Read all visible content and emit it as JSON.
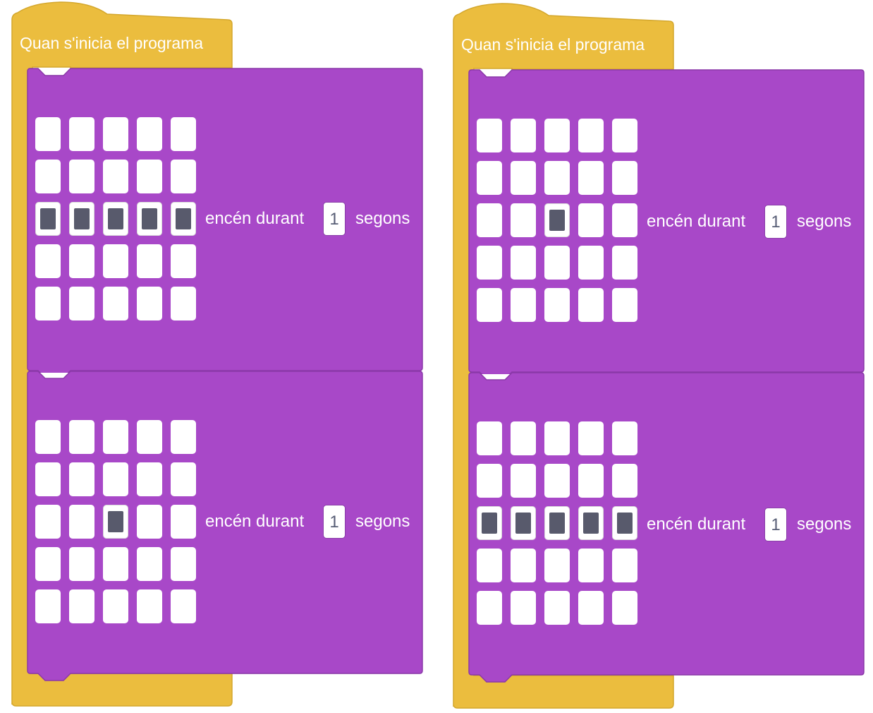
{
  "programs": [
    {
      "hat_label": "Quan s'inicia el programa",
      "blocks": [
        {
          "leds": [
            [
              0,
              0,
              0,
              0,
              0
            ],
            [
              0,
              0,
              0,
              0,
              0
            ],
            [
              1,
              1,
              1,
              1,
              1
            ],
            [
              0,
              0,
              0,
              0,
              0
            ],
            [
              0,
              0,
              0,
              0,
              0
            ]
          ],
          "label_before": "encén durant",
          "duration": "1",
          "label_after": "segons"
        },
        {
          "leds": [
            [
              0,
              0,
              0,
              0,
              0
            ],
            [
              0,
              0,
              0,
              0,
              0
            ],
            [
              0,
              0,
              1,
              0,
              0
            ],
            [
              0,
              0,
              0,
              0,
              0
            ],
            [
              0,
              0,
              0,
              0,
              0
            ]
          ],
          "label_before": "encén durant",
          "duration": "1",
          "label_after": "segons"
        }
      ]
    },
    {
      "hat_label": "Quan s'inicia el programa",
      "blocks": [
        {
          "leds": [
            [
              0,
              0,
              0,
              0,
              0
            ],
            [
              0,
              0,
              0,
              0,
              0
            ],
            [
              0,
              0,
              1,
              0,
              0
            ],
            [
              0,
              0,
              0,
              0,
              0
            ],
            [
              0,
              0,
              0,
              0,
              0
            ]
          ],
          "label_before": "encén durant",
          "duration": "1",
          "label_after": "segons"
        },
        {
          "leds": [
            [
              0,
              0,
              0,
              0,
              0
            ],
            [
              0,
              0,
              0,
              0,
              0
            ],
            [
              1,
              1,
              1,
              1,
              1
            ],
            [
              0,
              0,
              0,
              0,
              0
            ],
            [
              0,
              0,
              0,
              0,
              0
            ]
          ],
          "label_before": "encén durant",
          "duration": "1",
          "label_after": "segons"
        }
      ]
    }
  ],
  "colors": {
    "event_yellow": "#ebbd3e",
    "event_border": "#d4a72c",
    "looks_purple": "#a848c8",
    "looks_border": "#8a38a8",
    "led_on": "#585a6c",
    "led_off": "#ffffff"
  }
}
